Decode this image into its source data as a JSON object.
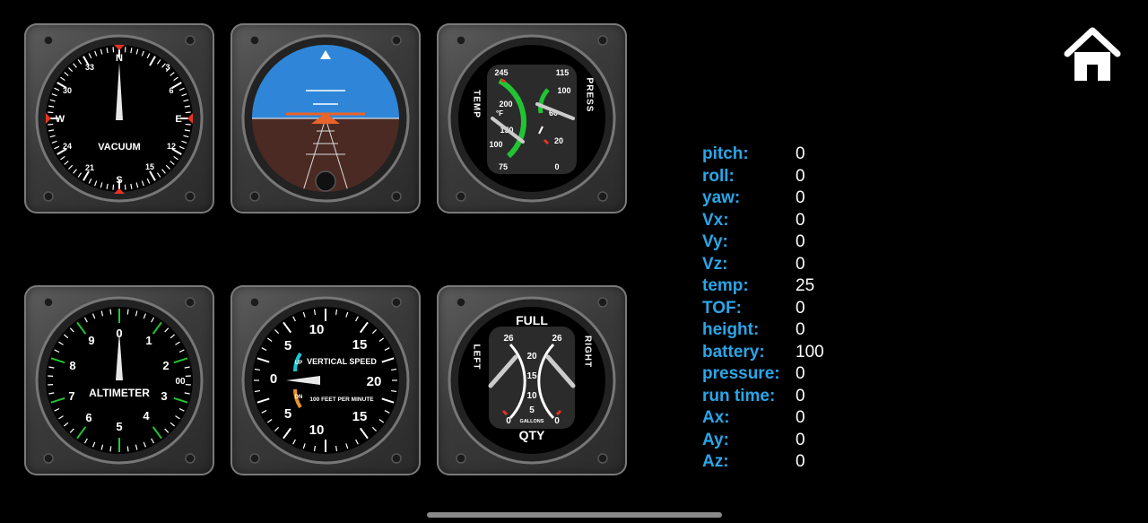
{
  "gauges": {
    "vacuum": {
      "label": "VACUUM",
      "marks": [
        "N",
        "3",
        "6",
        "E",
        "12",
        "15",
        "S",
        "21",
        "24",
        "W",
        "30",
        "33"
      ]
    },
    "altimeter": {
      "label": "ALTIMETER",
      "digits": [
        "0",
        "1",
        "2",
        "3",
        "4",
        "5",
        "6",
        "7",
        "8",
        "9"
      ],
      "code": "00"
    },
    "vsi": {
      "title": "VERTICAL SPEED",
      "subtitle": "100 FEET PER MINUTE",
      "up": "UP",
      "dn": "DN",
      "numbers": [
        "0",
        "5",
        "10",
        "15",
        "20",
        "15",
        "10",
        "5"
      ]
    },
    "engine": {
      "left_label": "TEMP",
      "right_label": "PRESS",
      "unit": "°F",
      "temp_scale": [
        "245",
        "200",
        "150",
        "100",
        "75"
      ],
      "press_scale": [
        "115",
        "100",
        "60",
        "20",
        "0"
      ]
    },
    "fuel": {
      "top": "FULL",
      "bottom": "QTY",
      "left": "LEFT",
      "right": "RIGHT",
      "unit": "GALLONS",
      "left_scale": [
        "26",
        "0"
      ],
      "right_scale": [
        "26",
        "0"
      ],
      "center_scale": [
        "20",
        "15",
        "10",
        "5"
      ]
    }
  },
  "telemetry": [
    {
      "label": "pitch:",
      "value": "0"
    },
    {
      "label": "roll:",
      "value": "0"
    },
    {
      "label": "yaw:",
      "value": "0"
    },
    {
      "label": "Vx:",
      "value": "0"
    },
    {
      "label": "Vy:",
      "value": "0"
    },
    {
      "label": "Vz:",
      "value": "0"
    },
    {
      "label": "temp:",
      "value": "25"
    },
    {
      "label": "TOF:",
      "value": "0"
    },
    {
      "label": "height:",
      "value": "0"
    },
    {
      "label": "battery:",
      "value": "100"
    },
    {
      "label": "pressure:",
      "value": "0"
    },
    {
      "label": "run time:",
      "value": "0"
    },
    {
      "label": "Ax:",
      "value": "0"
    },
    {
      "label": "Ay:",
      "value": "0"
    },
    {
      "label": "Az:",
      "value": "0"
    }
  ],
  "icons": {
    "home": "home-icon"
  },
  "colors": {
    "label_blue": "#2aa6e8",
    "sky": "#2f86d8",
    "ground": "#4a2a22",
    "green": "#22c433",
    "red": "#e63322"
  }
}
